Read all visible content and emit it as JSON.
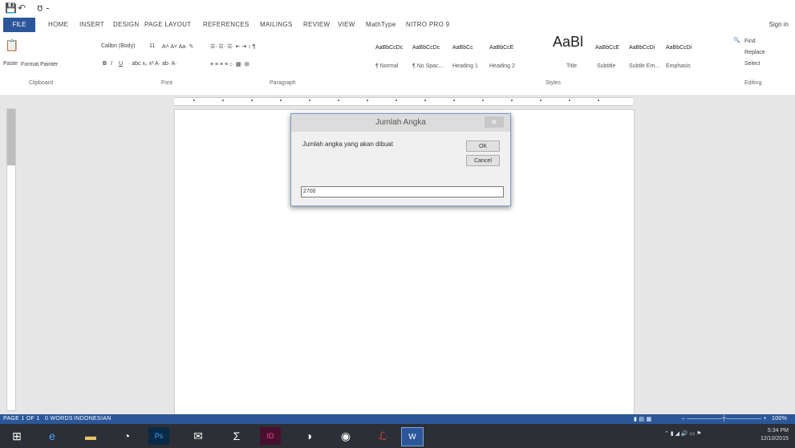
{
  "qat": {
    "save": "💾",
    "undo": "↶",
    "redo": "ʊ -"
  },
  "tabs": {
    "file": "FILE",
    "items": [
      "HOME",
      "INSERT",
      "DESIGN",
      "PAGE LAYOUT",
      "REFERENCES",
      "MAILINGS",
      "REVIEW",
      "VIEW",
      "MathType",
      "NITRO PRO 9"
    ],
    "signin": "Sign in"
  },
  "ribbon": {
    "paste": "Paste",
    "format_painter": "Format Painter",
    "font_name": "Calibri (Body)",
    "font_size": "11",
    "groups": {
      "clipboard": "Clipboard",
      "font": "Font",
      "paragraph": "Paragraph",
      "styles": "Styles",
      "editing": "Editing"
    },
    "styles": [
      {
        "sample": "AaBbCcDc",
        "name": "¶ Normal"
      },
      {
        "sample": "AaBbCcDc",
        "name": "¶ No Spac..."
      },
      {
        "sample": "AaBbCc",
        "name": "Heading 1"
      },
      {
        "sample": "AaBbCcE",
        "name": "Heading 2"
      },
      {
        "sample": "AaBl",
        "name": "Title"
      },
      {
        "sample": "AaBbCcE",
        "name": "Subtitle"
      },
      {
        "sample": "AaBbCcDi",
        "name": "Subtle Em..."
      },
      {
        "sample": "AaBbCcDi",
        "name": "Emphasis"
      }
    ],
    "editing": {
      "find": "Find",
      "replace": "Replace",
      "select": "Select"
    }
  },
  "dialog": {
    "title": "Jumlah Angka",
    "close": "✕",
    "prompt": "Jumlah angka yang akan dibuat",
    "ok": "OK",
    "cancel": "Cancel",
    "input_value": "2700"
  },
  "status": {
    "page": "PAGE 1 OF 1",
    "words": "0 WORDS",
    "language": "INDONESIAN",
    "zoom": "100%"
  },
  "taskbar": {
    "icons": [
      {
        "name": "windows-icon",
        "glyph": "⊞"
      },
      {
        "name": "ie-icon",
        "glyph": "e"
      },
      {
        "name": "explorer-icon",
        "glyph": "▬"
      },
      {
        "name": "ccleaner-icon",
        "glyph": "◔"
      },
      {
        "name": "photoshop-icon",
        "glyph": "Ps"
      },
      {
        "name": "mail-icon",
        "glyph": "✉"
      },
      {
        "name": "sigma-icon",
        "glyph": "Σ"
      },
      {
        "name": "indesign-icon",
        "glyph": "ID"
      },
      {
        "name": "media-icon",
        "glyph": "◑"
      },
      {
        "name": "chrome-icon",
        "glyph": "◉"
      },
      {
        "name": "acrobat-icon",
        "glyph": "ℒ"
      },
      {
        "name": "word-icon",
        "glyph": "W"
      }
    ],
    "time": "5:34 PM",
    "date": "12/10/2015"
  }
}
